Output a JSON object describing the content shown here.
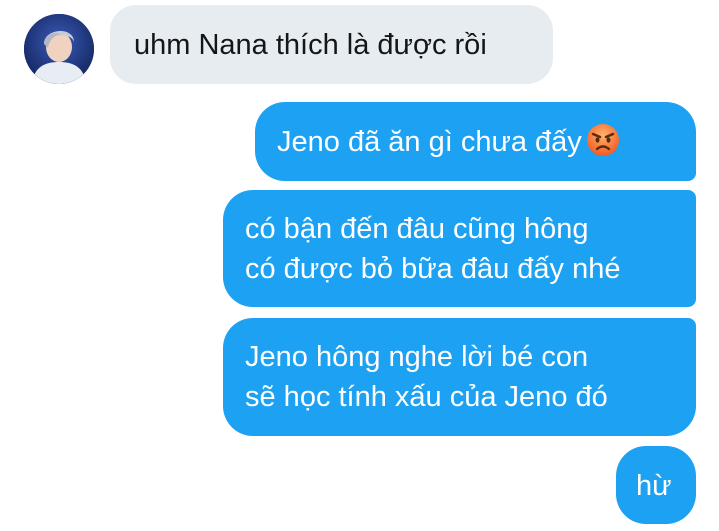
{
  "conversation": {
    "contact_avatar": "avatar-photo",
    "received": [
      {
        "text": "uhm Nana thích là được rồi"
      }
    ],
    "sent": [
      {
        "text": "Jeno đã ăn gì chưa đấy",
        "emoji": "angry-face-emoji"
      },
      {
        "lines": [
          "có bận đến đâu cũng hông",
          "có được bỏ bữa đâu đấy nhé"
        ]
      },
      {
        "lines": [
          "Jeno hông nghe lời bé con",
          "sẽ học tính xấu của Jeno đó"
        ]
      },
      {
        "text": "hừ"
      }
    ]
  },
  "colors": {
    "sent_bubble": "#1da1f2",
    "received_bubble": "#e6ecf0",
    "sent_text": "#ffffff",
    "received_text": "#14171a"
  }
}
